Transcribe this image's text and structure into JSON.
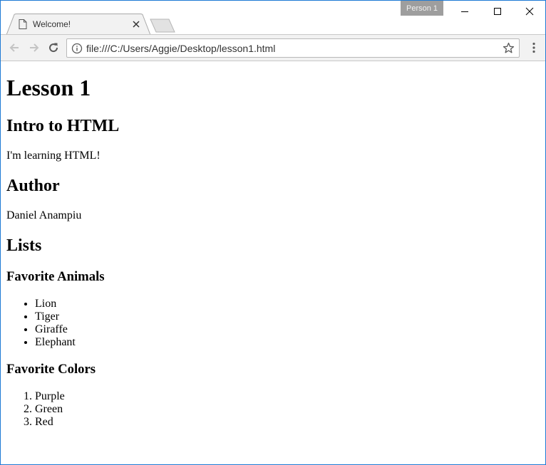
{
  "browser": {
    "tab_title": "Welcome!",
    "profile_label": "Person 1",
    "url": "file:///C:/Users/Aggie/Desktop/lesson1.html"
  },
  "page": {
    "title": "Lesson 1",
    "intro_heading": "Intro to HTML",
    "intro_text": "I'm learning HTML!",
    "author_heading": "Author",
    "author_name": "Daniel Anampiu",
    "lists_heading": "Lists",
    "animals_heading": "Favorite Animals",
    "animals": [
      "Lion",
      "Tiger",
      "Giraffe",
      "Elephant"
    ],
    "colors_heading": "Favorite Colors",
    "colors": [
      "Purple",
      "Green",
      "Red"
    ]
  }
}
